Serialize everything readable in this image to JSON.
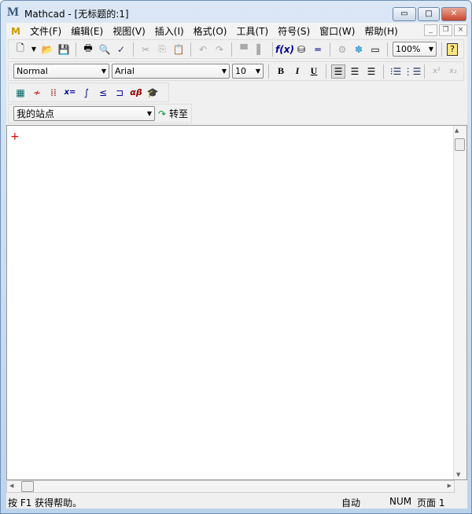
{
  "window": {
    "title": "Mathcad - [无标题的:1]",
    "logo": "M"
  },
  "caption_buttons": {
    "minimize": "▭",
    "maximize": "□",
    "close": "✕"
  },
  "menu": [
    "文件(F)",
    "编辑(E)",
    "视图(V)",
    "插入(I)",
    "格式(O)",
    "工具(T)",
    "符号(S)",
    "窗口(W)",
    "帮助(H)"
  ],
  "mdi_buttons": {
    "minimize": "_",
    "restore": "❐",
    "close": "×"
  },
  "standard_toolbar": {
    "zoom": "100%",
    "help": "?"
  },
  "format_toolbar": {
    "style": "Normal",
    "font": "Arial",
    "size": "10",
    "bold": "B",
    "italic": "I",
    "underline": "U",
    "superscript": "x²",
    "subscript": "x₂"
  },
  "math_toolbar": {
    "evaluate": "x=",
    "greek": "αβ"
  },
  "web_toolbar": {
    "site": "我的站点",
    "go": "转至"
  },
  "document": {
    "cursor": "+"
  },
  "status": {
    "help": "按 F1 获得帮助。",
    "mode": "自动",
    "num": "NUM",
    "page": "页面 1"
  }
}
